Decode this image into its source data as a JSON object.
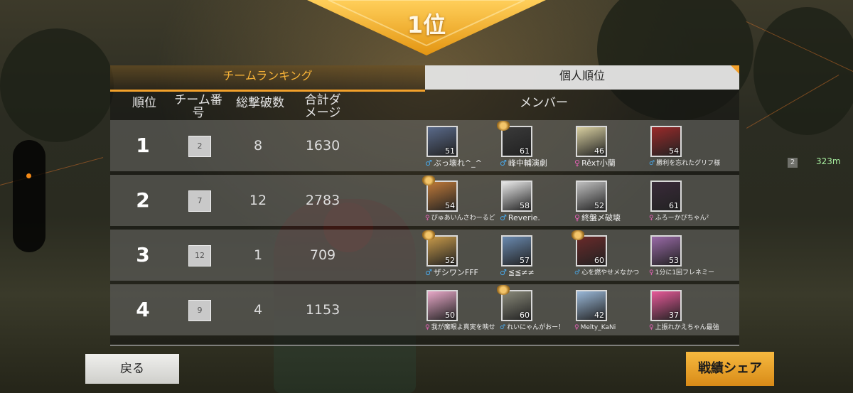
{
  "banner": {
    "rank_text": "1位"
  },
  "tabs": {
    "team_ranking": "チームランキング",
    "individual_rank": "個人順位"
  },
  "columns": {
    "rank": "順位",
    "team_no": "チーム番号",
    "kills": "総撃破数",
    "damage": "合計ダメージ",
    "members": "メンバー"
  },
  "rows": [
    {
      "rank": "1",
      "team": "2",
      "kills": "8",
      "damage": "1630",
      "members": [
        {
          "name": "ぶっ壊れ^_^",
          "level": "51",
          "gender": "♂",
          "crest": false
        },
        {
          "name": "峰中輔演劇",
          "level": "61",
          "gender": "♂",
          "crest": true
        },
        {
          "name": "Rêx†小蘭",
          "level": "46",
          "gender": "♀",
          "crest": false
        },
        {
          "name": "勝利を忘れたグリフ様",
          "level": "54",
          "gender": "♂",
          "crest": false
        }
      ]
    },
    {
      "rank": "2",
      "team": "7",
      "kills": "12",
      "damage": "2783",
      "members": [
        {
          "name": "ぴゅあいんさわーるど",
          "level": "54",
          "gender": "♀",
          "crest": true
        },
        {
          "name": "Reverie.",
          "level": "58",
          "gender": "♂",
          "crest": false
        },
        {
          "name": "終盤〆破壊",
          "level": "52",
          "gender": "♀",
          "crest": false
        },
        {
          "name": "ふろーかぴちゃん²",
          "level": "61",
          "gender": "♀",
          "crest": false
        }
      ]
    },
    {
      "rank": "3",
      "team": "12",
      "kills": "1",
      "damage": "709",
      "members": [
        {
          "name": "ザシワンFFF",
          "level": "52",
          "gender": "♂",
          "crest": true
        },
        {
          "name": "≦≦≠≠",
          "level": "57",
          "gender": "♂",
          "crest": false
        },
        {
          "name": "心を燃やせメなかつ",
          "level": "60",
          "gender": "♂",
          "crest": true
        },
        {
          "name": "1分に1回フレネミー",
          "level": "53",
          "gender": "♀",
          "crest": false
        }
      ]
    },
    {
      "rank": "4",
      "team": "9",
      "kills": "4",
      "damage": "1153",
      "members": [
        {
          "name": "我が魔眼よ真実を映せ",
          "level": "50",
          "gender": "♀",
          "crest": false
        },
        {
          "name": "れいにゃんがおー！",
          "level": "60",
          "gender": "♂",
          "crest": true
        },
        {
          "name": "Melty_KaNi",
          "level": "42",
          "gender": "♀",
          "crest": false
        },
        {
          "name": "上振れかえちゃん最強",
          "level": "37",
          "gender": "♀",
          "crest": false
        }
      ]
    }
  ],
  "buttons": {
    "back": "戻る",
    "share": "戦績シェア"
  },
  "hud": {
    "minimap_badge": "2",
    "distance": "323m"
  },
  "colors": {
    "accent": "#f3a12b",
    "male": "#4aa8e8",
    "female": "#e862b8"
  },
  "icons": {
    "avatar": "player-avatar-icon",
    "crest": "rank-crest-icon"
  }
}
